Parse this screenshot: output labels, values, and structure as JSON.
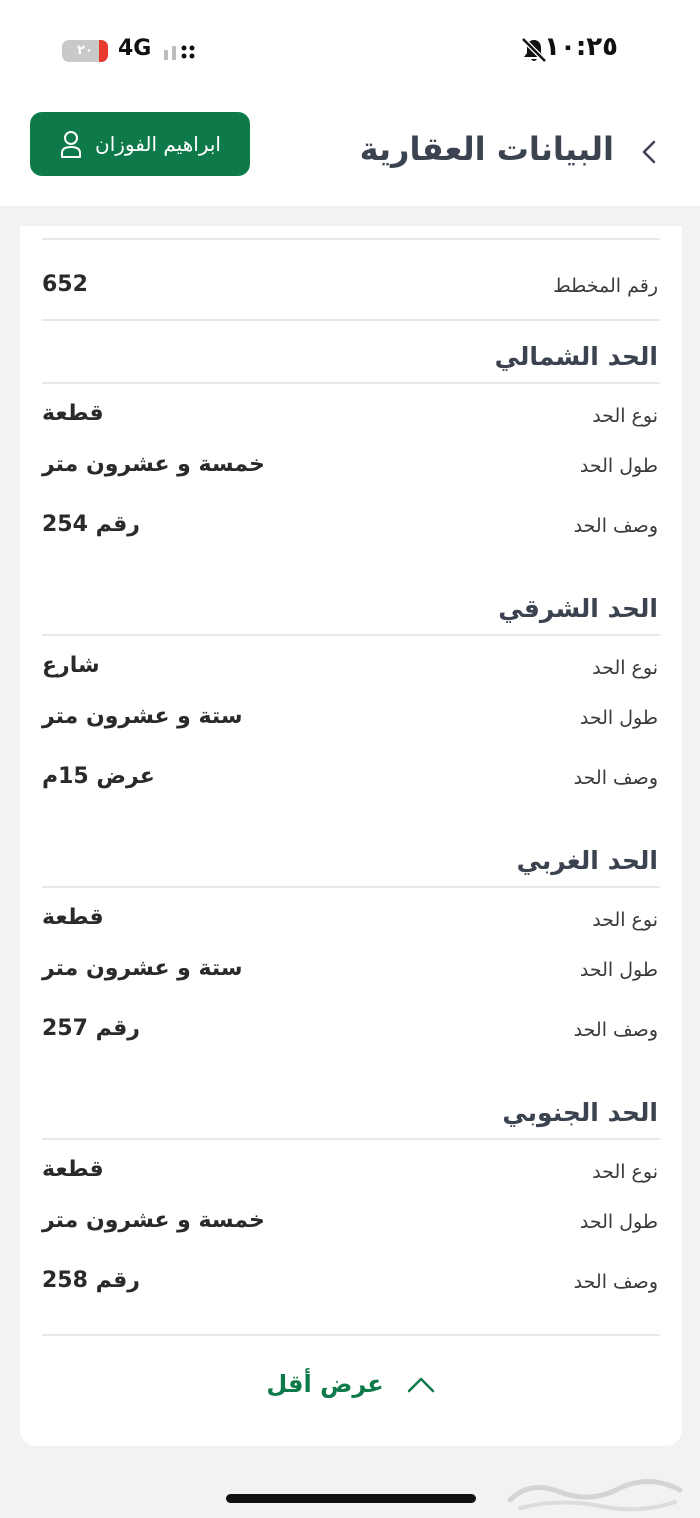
{
  "status_bar": {
    "time": "١٠:٢٥",
    "network": "4G",
    "battery_level": "٢٠",
    "battery_fraction": 0.2,
    "battery_color": "#e8392f"
  },
  "header": {
    "title": "البيانات العقارية",
    "user_name": "ابراهيم الفوزان",
    "accent_color": "#0e7a49"
  },
  "plan": {
    "label": "رقم المخطط",
    "value": "652"
  },
  "boundaries": [
    {
      "title": "الحد الشمالي",
      "rows": [
        {
          "label": "نوع الحد",
          "value": "قطعة"
        },
        {
          "label": "طول الحد",
          "value": "خمسة و عشرون متر"
        },
        {
          "label": "وصف الحد",
          "value": "رقم 254"
        }
      ]
    },
    {
      "title": "الحد الشرقي",
      "rows": [
        {
          "label": "نوع الحد",
          "value": "شارع"
        },
        {
          "label": "طول الحد",
          "value": "ستة و عشرون متر"
        },
        {
          "label": "وصف الحد",
          "value": "عرض 15م"
        }
      ]
    },
    {
      "title": "الحد الغربي",
      "rows": [
        {
          "label": "نوع الحد",
          "value": "قطعة"
        },
        {
          "label": "طول الحد",
          "value": "ستة و عشرون متر"
        },
        {
          "label": "وصف الحد",
          "value": "رقم 257"
        }
      ]
    },
    {
      "title": "الحد الجنوبي",
      "rows": [
        {
          "label": "نوع الحد",
          "value": "قطعة"
        },
        {
          "label": "طول الحد",
          "value": "خمسة و عشرون متر"
        },
        {
          "label": "وصف الحد",
          "value": "رقم 258"
        }
      ]
    }
  ],
  "footer": {
    "show_less_label": "عرض أقل"
  }
}
